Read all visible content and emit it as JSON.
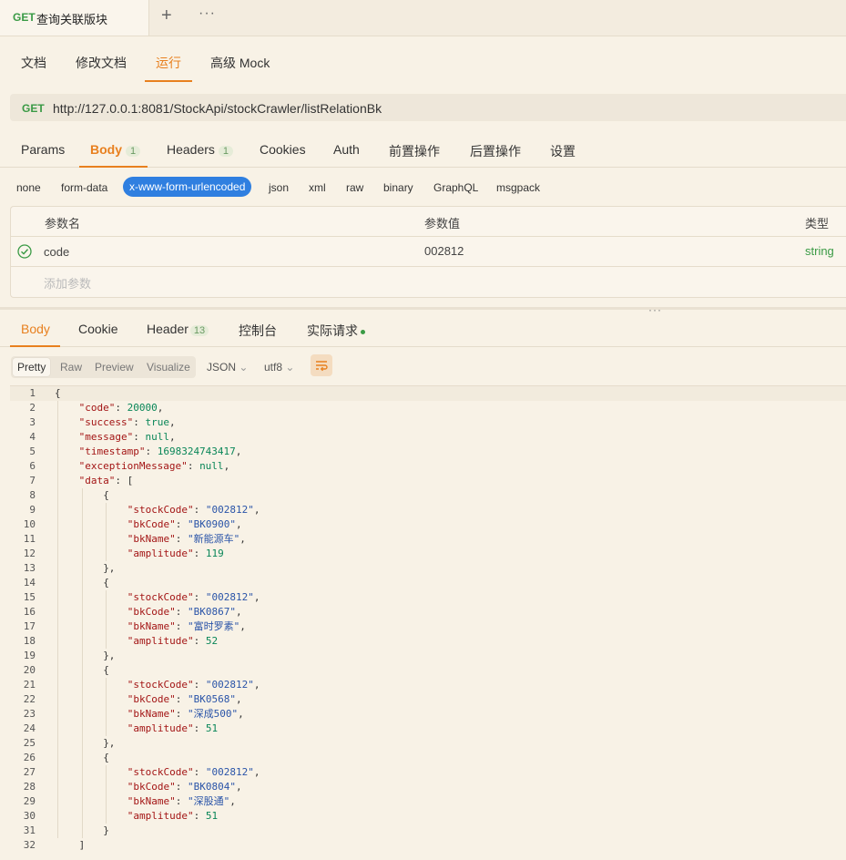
{
  "tabs": {
    "method": "GET",
    "title": "查询关联版块",
    "add": "+",
    "more": "···"
  },
  "subtabs": [
    "文档",
    "修改文档",
    "运行",
    "高级 Mock"
  ],
  "url": {
    "method": "GET",
    "value": "http://127.0.0.1:8081/StockApi/stockCrawler/listRelationBk"
  },
  "request_tabs": [
    {
      "label": "Params",
      "badge": ""
    },
    {
      "label": "Body",
      "badge": "1"
    },
    {
      "label": "Headers",
      "badge": "1"
    },
    {
      "label": "Cookies",
      "badge": ""
    },
    {
      "label": "Auth",
      "badge": ""
    },
    {
      "label": "前置操作",
      "badge": ""
    },
    {
      "label": "后置操作",
      "badge": ""
    },
    {
      "label": "设置",
      "badge": ""
    }
  ],
  "body_types": [
    "none",
    "form-data",
    "x-www-form-urlencoded",
    "json",
    "xml",
    "raw",
    "binary",
    "GraphQL",
    "msgpack"
  ],
  "params": {
    "headers": {
      "name": "参数名",
      "value": "参数值",
      "type": "类型"
    },
    "rows": [
      {
        "name": "code",
        "value": "002812",
        "type": "string"
      }
    ],
    "add_placeholder": "添加参数"
  },
  "response_tabs": [
    {
      "label": "Body",
      "badge": ""
    },
    {
      "label": "Cookie",
      "badge": ""
    },
    {
      "label": "Header",
      "badge": "13"
    },
    {
      "label": "控制台",
      "badge": ""
    },
    {
      "label": "实际请求",
      "badge": ""
    }
  ],
  "view_modes": [
    "Pretty",
    "Raw",
    "Preview",
    "Visualize"
  ],
  "format": "JSON",
  "encoding": "utf8",
  "code_lines": [
    [
      [
        0,
        "p",
        "{"
      ]
    ],
    [
      [
        1,
        "k",
        "\"code\""
      ],
      [
        1,
        "p",
        ": "
      ],
      [
        1,
        "n",
        "20000"
      ],
      [
        1,
        "p",
        ","
      ]
    ],
    [
      [
        1,
        "k",
        "\"success\""
      ],
      [
        1,
        "p",
        ": "
      ],
      [
        1,
        "n",
        "true"
      ],
      [
        1,
        "p",
        ","
      ]
    ],
    [
      [
        1,
        "k",
        "\"message\""
      ],
      [
        1,
        "p",
        ": "
      ],
      [
        1,
        "n",
        "null"
      ],
      [
        1,
        "p",
        ","
      ]
    ],
    [
      [
        1,
        "k",
        "\"timestamp\""
      ],
      [
        1,
        "p",
        ": "
      ],
      [
        1,
        "n",
        "1698324743417"
      ],
      [
        1,
        "p",
        ","
      ]
    ],
    [
      [
        1,
        "k",
        "\"exceptionMessage\""
      ],
      [
        1,
        "p",
        ": "
      ],
      [
        1,
        "n",
        "null"
      ],
      [
        1,
        "p",
        ","
      ]
    ],
    [
      [
        1,
        "k",
        "\"data\""
      ],
      [
        1,
        "p",
        ": ["
      ]
    ],
    [
      [
        2,
        "p",
        "{"
      ]
    ],
    [
      [
        3,
        "k",
        "\"stockCode\""
      ],
      [
        3,
        "p",
        ": "
      ],
      [
        3,
        "s",
        "\"002812\""
      ],
      [
        3,
        "p",
        ","
      ]
    ],
    [
      [
        3,
        "k",
        "\"bkCode\""
      ],
      [
        3,
        "p",
        ": "
      ],
      [
        3,
        "s",
        "\"BK0900\""
      ],
      [
        3,
        "p",
        ","
      ]
    ],
    [
      [
        3,
        "k",
        "\"bkName\""
      ],
      [
        3,
        "p",
        ": "
      ],
      [
        3,
        "s",
        "\"新能源车\""
      ],
      [
        3,
        "p",
        ","
      ]
    ],
    [
      [
        3,
        "k",
        "\"amplitude\""
      ],
      [
        3,
        "p",
        ": "
      ],
      [
        3,
        "n",
        "119"
      ]
    ],
    [
      [
        2,
        "p",
        "},"
      ]
    ],
    [
      [
        2,
        "p",
        "{"
      ]
    ],
    [
      [
        3,
        "k",
        "\"stockCode\""
      ],
      [
        3,
        "p",
        ": "
      ],
      [
        3,
        "s",
        "\"002812\""
      ],
      [
        3,
        "p",
        ","
      ]
    ],
    [
      [
        3,
        "k",
        "\"bkCode\""
      ],
      [
        3,
        "p",
        ": "
      ],
      [
        3,
        "s",
        "\"BK0867\""
      ],
      [
        3,
        "p",
        ","
      ]
    ],
    [
      [
        3,
        "k",
        "\"bkName\""
      ],
      [
        3,
        "p",
        ": "
      ],
      [
        3,
        "s",
        "\"富时罗素\""
      ],
      [
        3,
        "p",
        ","
      ]
    ],
    [
      [
        3,
        "k",
        "\"amplitude\""
      ],
      [
        3,
        "p",
        ": "
      ],
      [
        3,
        "n",
        "52"
      ]
    ],
    [
      [
        2,
        "p",
        "},"
      ]
    ],
    [
      [
        2,
        "p",
        "{"
      ]
    ],
    [
      [
        3,
        "k",
        "\"stockCode\""
      ],
      [
        3,
        "p",
        ": "
      ],
      [
        3,
        "s",
        "\"002812\""
      ],
      [
        3,
        "p",
        ","
      ]
    ],
    [
      [
        3,
        "k",
        "\"bkCode\""
      ],
      [
        3,
        "p",
        ": "
      ],
      [
        3,
        "s",
        "\"BK0568\""
      ],
      [
        3,
        "p",
        ","
      ]
    ],
    [
      [
        3,
        "k",
        "\"bkName\""
      ],
      [
        3,
        "p",
        ": "
      ],
      [
        3,
        "s",
        "\"深成500\""
      ],
      [
        3,
        "p",
        ","
      ]
    ],
    [
      [
        3,
        "k",
        "\"amplitude\""
      ],
      [
        3,
        "p",
        ": "
      ],
      [
        3,
        "n",
        "51"
      ]
    ],
    [
      [
        2,
        "p",
        "},"
      ]
    ],
    [
      [
        2,
        "p",
        "{"
      ]
    ],
    [
      [
        3,
        "k",
        "\"stockCode\""
      ],
      [
        3,
        "p",
        ": "
      ],
      [
        3,
        "s",
        "\"002812\""
      ],
      [
        3,
        "p",
        ","
      ]
    ],
    [
      [
        3,
        "k",
        "\"bkCode\""
      ],
      [
        3,
        "p",
        ": "
      ],
      [
        3,
        "s",
        "\"BK0804\""
      ],
      [
        3,
        "p",
        ","
      ]
    ],
    [
      [
        3,
        "k",
        "\"bkName\""
      ],
      [
        3,
        "p",
        ": "
      ],
      [
        3,
        "s",
        "\"深股通\""
      ],
      [
        3,
        "p",
        ","
      ]
    ],
    [
      [
        3,
        "k",
        "\"amplitude\""
      ],
      [
        3,
        "p",
        ": "
      ],
      [
        3,
        "n",
        "51"
      ]
    ],
    [
      [
        2,
        "p",
        "}"
      ]
    ],
    [
      [
        1,
        "p",
        "]"
      ]
    ]
  ],
  "colors": {
    "accent": "#e8801f",
    "get": "#3a9a45",
    "selected_body_type": "#2f7fe0"
  }
}
